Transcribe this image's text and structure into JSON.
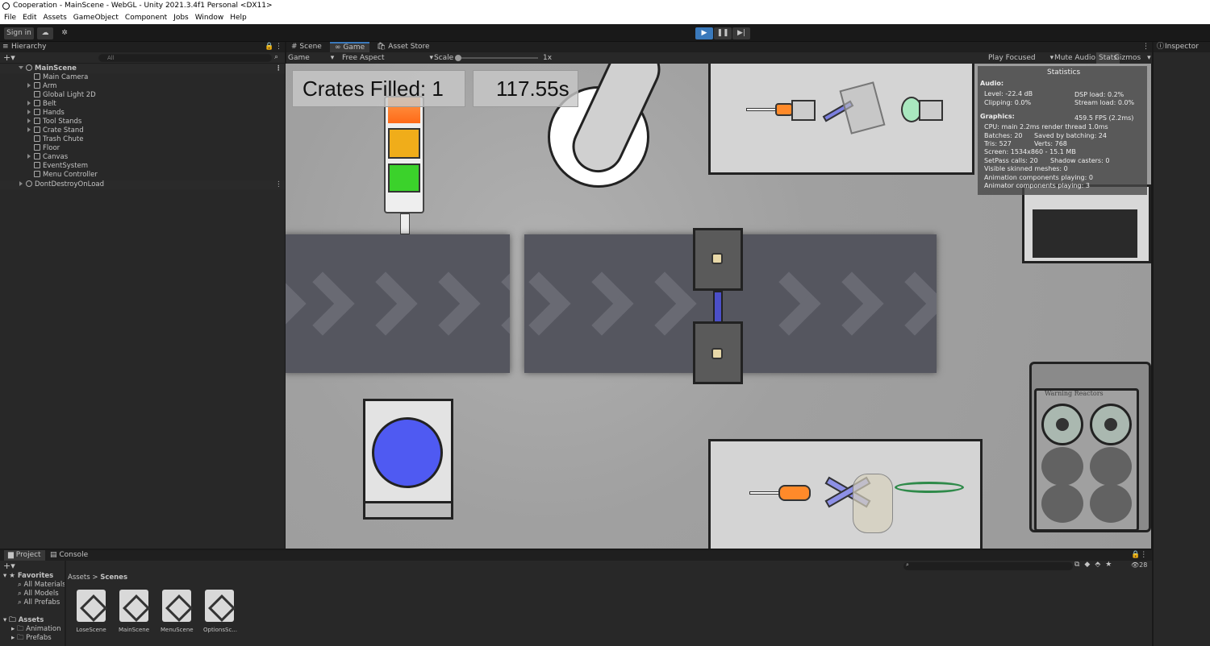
{
  "window": {
    "title": "Cooperation - MainScene - WebGL - Unity 2021.3.4f1 Personal <DX11>"
  },
  "menu": [
    "File",
    "Edit",
    "Assets",
    "GameObject",
    "Component",
    "Jobs",
    "Window",
    "Help"
  ],
  "toolbar": {
    "signin": "Sign in",
    "play_icon": "play-icon",
    "pause_icon": "pause-icon",
    "step_icon": "step-icon",
    "accent": "#3a79bb"
  },
  "hierarchy": {
    "tab": "Hierarchy",
    "search_placeholder": "All",
    "scene": "MainScene",
    "items": [
      "Main Camera",
      "Arm",
      "Global Light 2D",
      "Belt",
      "Hands",
      "Tool Stands",
      "Crate Stand",
      "Trash Chute",
      "Floor",
      "Canvas",
      "EventSystem",
      "Menu Controller"
    ],
    "ddol": "DontDestroyOnLoad"
  },
  "view_tabs": {
    "scene": "Scene",
    "game": "Game",
    "store": "Asset Store"
  },
  "game_toolbar": {
    "display": "Game",
    "aspect": "Free Aspect",
    "scale_label": "Scale",
    "scale_value": "1x",
    "play_focused": "Play Focused",
    "mute": "Mute Audio",
    "stats": "Stats",
    "gizmos": "Gizmos"
  },
  "hud": {
    "crates": "Crates Filled:  1",
    "timer": "117.55s"
  },
  "reactor_label": "Warning Reactors",
  "stats": {
    "title": "Statistics",
    "audio_h": "Audio:",
    "level": "Level: -22.4 dB",
    "clipping": "Clipping: 0.0%",
    "dsp": "DSP load: 0.2%",
    "stream": "Stream load: 0.0%",
    "graphics_h": "Graphics:",
    "fps": "459.5 FPS (2.2ms)",
    "cpu": "CPU: main 2.2ms  render thread 1.0ms",
    "batches": "Batches: 20",
    "saved": "Saved by batching: 24",
    "tris": "Tris: 527",
    "verts": "Verts: 768",
    "screen": "Screen: 1534x860 - 15.1 MB",
    "setpass": "SetPass calls: 20",
    "shadow": "Shadow casters: 0",
    "skinned": "Visible skinned meshes: 0",
    "anim": "Animation components playing: 0",
    "animator": "Animator components playing: 3"
  },
  "inspector": {
    "tab": "Inspector"
  },
  "project": {
    "tab_project": "Project",
    "tab_console": "Console",
    "favorites": "Favorites",
    "fav_items": [
      "All Materials",
      "All Models",
      "All Prefabs"
    ],
    "assets": "Assets",
    "asset_folders": [
      "Animation",
      "Prefabs"
    ],
    "breadcrumb_root": "Assets",
    "breadcrumb_leaf": "Scenes",
    "hidden_count": "28",
    "scenes": [
      "LoseScene",
      "MainScene",
      "MenuScene",
      "OptionsSc..."
    ]
  }
}
